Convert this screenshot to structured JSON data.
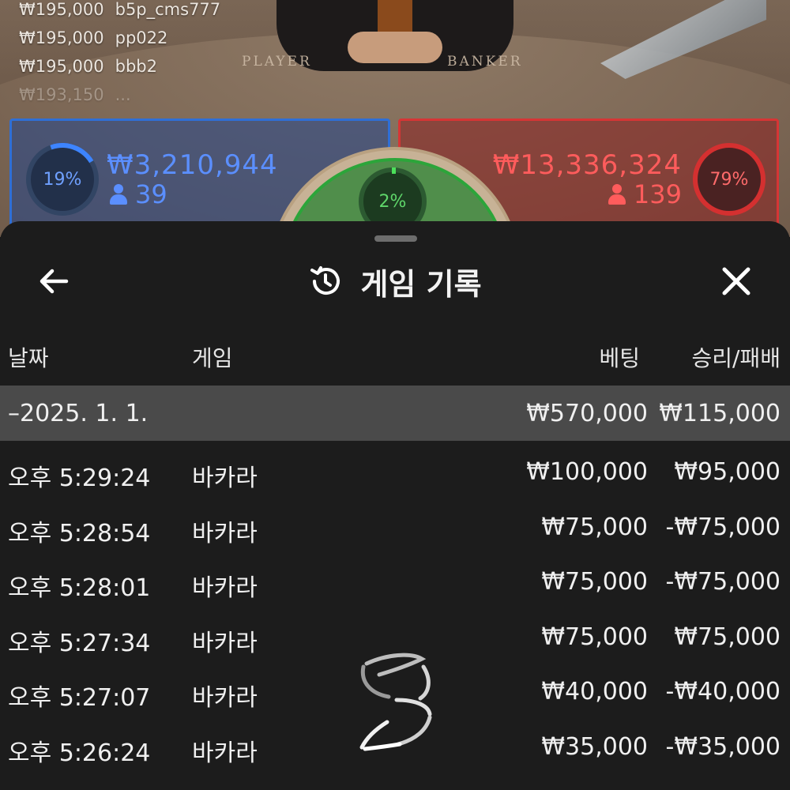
{
  "background": {
    "chat": [
      {
        "amount": "₩195,000",
        "user": "b5p_cms777"
      },
      {
        "amount": "₩195,000",
        "user": "pp022"
      },
      {
        "amount": "₩195,000",
        "user": "bbb2"
      },
      {
        "amount": "₩193,150",
        "user": "..."
      }
    ],
    "table_labels": {
      "player": "PLAYER",
      "banker": "BANKER"
    },
    "player": {
      "percent": "19%",
      "amount": "₩3,210,944",
      "count": "39",
      "color": "#2f6fd6"
    },
    "banker": {
      "percent": "79%",
      "amount": "₩13,336,324",
      "count": "139",
      "color": "#d63535"
    },
    "tie": {
      "percent": "2%",
      "color": "#2ca53a"
    }
  },
  "sheet": {
    "title": "게임 기록",
    "icons": {
      "back": "back-arrow-icon",
      "title": "history-icon",
      "close": "close-icon",
      "loading": "loading-spinner-icon"
    },
    "columns": {
      "date": "날짜",
      "game": "게임",
      "bet": "베팅",
      "winloss": "승리/패배"
    },
    "summary": {
      "date": "–2025. 1. 1.",
      "bet": "₩570,000",
      "winloss": "₩115,000"
    },
    "rows": [
      {
        "time": "오후 5:29:24",
        "game": "바카라",
        "bet": "₩100,000",
        "winloss": "₩95,000"
      },
      {
        "time": "오후 5:28:54",
        "game": "바카라",
        "bet": "₩75,000",
        "winloss": "-₩75,000"
      },
      {
        "time": "오후 5:28:01",
        "game": "바카라",
        "bet": "₩75,000",
        "winloss": "-₩75,000"
      },
      {
        "time": "오후 5:27:34",
        "game": "바카라",
        "bet": "₩75,000",
        "winloss": "₩75,000"
      },
      {
        "time": "오후 5:27:07",
        "game": "바카라",
        "bet": "₩40,000",
        "winloss": "-₩40,000"
      },
      {
        "time": "오후 5:26:24",
        "game": "바카라",
        "bet": "₩35,000",
        "winloss": "-₩35,000"
      }
    ]
  }
}
